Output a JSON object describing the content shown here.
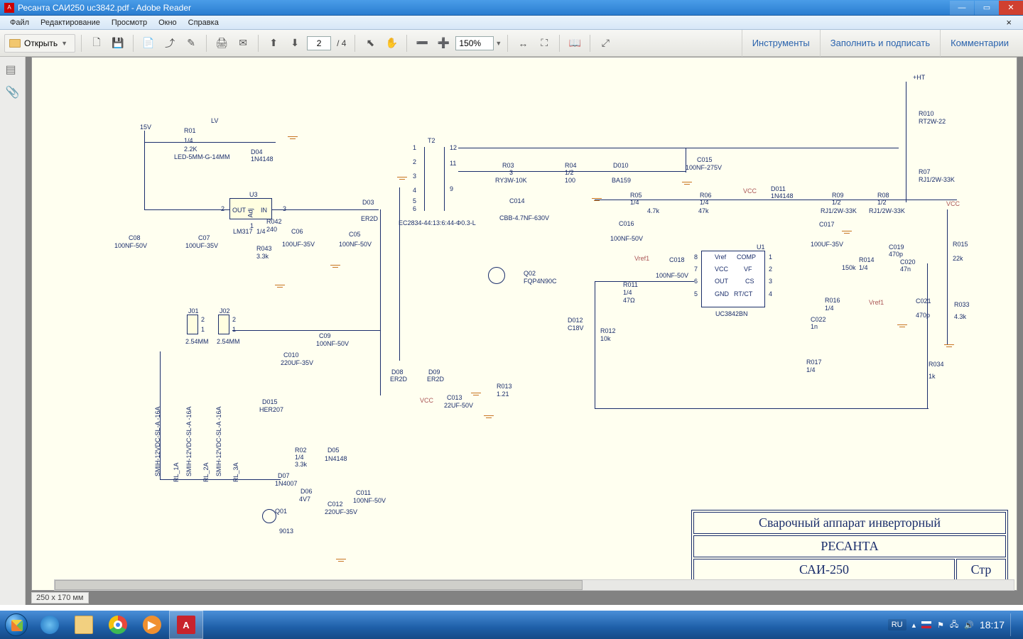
{
  "window": {
    "title": "Ресанта САИ250 uc3842.pdf - Adobe Reader",
    "app": "Adobe Reader"
  },
  "menu": {
    "file": "Файл",
    "edit": "Редактирование",
    "view": "Просмотр",
    "window": "Окно",
    "help": "Справка"
  },
  "toolbar": {
    "open": "Открыть",
    "page_current": "2",
    "page_total": "/ 4",
    "zoom": "150%"
  },
  "right_panel": {
    "tools": "Инструменты",
    "fill_sign": "Заполнить и подписать",
    "comments": "Комментарии"
  },
  "doc_status": {
    "dims": "250 x 170 мм"
  },
  "title_block": {
    "row1": "Сварочный аппарат инверторный",
    "row2": "РЕСАНТА",
    "row3": "САИ-250",
    "row3_right": "Стр"
  },
  "schematic_labels": {
    "v15": "15V",
    "r01a": "R01",
    "r01b": "1/4",
    "r01c": "2.2K",
    "lv": "LV",
    "led": "LED-5MM-G-14MM",
    "d04a": "D04",
    "d04b": "1N4148",
    "u3": "U3",
    "u3_out": "OUT",
    "u3_in": "IN",
    "u3_adj": "Adj",
    "lm317": "LM317",
    "r042a": "R042",
    "r042b": "1/4",
    "r042c": "240",
    "r043a": "R043",
    "r043b": "3.3k",
    "c08a": "C08",
    "c08b": "100NF-50V",
    "c07a": "C07",
    "c07b": "100UF-35V",
    "c06a": "C06",
    "c06b": "100UF-35V",
    "c05a": "C05",
    "c05b": "100NF-50V",
    "d03a": "D03",
    "d03b": "ER2D",
    "t2": "T2",
    "t2_1": "1",
    "t2_2": "2",
    "t2_3": "3",
    "t2_4": "4",
    "t2_5": "5",
    "t2_6": "6",
    "t2_9": "9",
    "t2_11": "11",
    "t2_12": "12",
    "trans": "EC2834-44:13:6:44-Φ0.3-L",
    "r03a": "R03",
    "r03b": "3",
    "r03c": "RY3W-10K",
    "r04a": "R04",
    "r04b": "1/2",
    "r04c": "100",
    "d010a": "D010",
    "d010b": "BA159",
    "c014a": "C014",
    "c014b": "CBB-4.7NF-630V",
    "c015a": "C015",
    "c015b": "100NF-275V",
    "r05a": "R05",
    "r05b": "1/4",
    "r05c": "4.7k",
    "r06a": "R06",
    "r06b": "1/4",
    "r06c": "47k",
    "c016a": "C016",
    "c016b": "100NF-50V",
    "vcc": "VCC",
    "d011a": "D011",
    "d011b": "1N4148",
    "r09a": "R09",
    "r09b": "1/2",
    "r09c": "RJ1/2W-33K",
    "r08a": "R08",
    "r08b": "1/2",
    "r08c": "RJ1/2W-33K",
    "r07a": "R07",
    "r07b": "RJ1/2W-33K",
    "r010a": "R010",
    "r010b": "RT2W-22",
    "ht": "+HT",
    "c017a": "C017",
    "c017b": "100UF-35V",
    "c018a": "C018",
    "c018b": "100NF-50V",
    "vref1a": "Vref1",
    "vref1b": "Vref1",
    "u1": "U1",
    "u1_vref": "Vref",
    "u1_comp": "COMP",
    "u1_vcc": "VCC",
    "u1_vf": "VF",
    "u1_out": "OUT",
    "u1_cs": "CS",
    "u1_gnd": "GND",
    "u1_rtct": "RT/CT",
    "u1_p1": "1",
    "u1_p2": "2",
    "u1_p3": "3",
    "u1_p4": "4",
    "u1_p5": "5",
    "u1_p6": "6",
    "u1_p7": "7",
    "u1_p8": "8",
    "uc3842": "UC3842BN",
    "r014a": "R014",
    "r014b": "1/4",
    "r014c": "150k",
    "c019a": "C019",
    "c019b": "470p",
    "c020a": "C020",
    "c020b": "47n",
    "r015a": "R015",
    "r015b": "22k",
    "r033a": "R033",
    "r033b": "4.3k",
    "r034a": "R034",
    "r034b": "1k",
    "c021a": "C021",
    "c021b": "470p",
    "r016a": "R016",
    "r016b": "1/4",
    "c022a": "C022",
    "c022b": "1n",
    "r017a": "R017",
    "r017b": "1/4",
    "r011a": "R011",
    "r011b": "1/4",
    "r011c": "47Ω",
    "q02a": "Q02",
    "q02b": "FQP4N90C",
    "d012a": "D012",
    "d012b": "C18V",
    "r012a": "R012",
    "r012b": "10k",
    "r013a": "R013",
    "r013b": "1.21",
    "c013a": "C013",
    "c013b": "22UF-50V",
    "d08a": "D08",
    "d08b": "ER2D",
    "d09a": "D09",
    "d09b": "ER2D",
    "j01a": "J01",
    "j01b": "2.54MM",
    "j02a": "J02",
    "j02b": "2.54MM",
    "j_1": "1",
    "j_2": "2",
    "c09a": "C09",
    "c09b": "100NF-50V",
    "c010a": "C010",
    "c010b": "220UF-35V",
    "d015a": "D015",
    "d015b": "HER207",
    "rl1": "SMIH-12VDC-SL-A -16A",
    "rl2": "SMIH-12VDC-SL-A -16A",
    "rl3": "SMIH-12VDC-SL-A -16A",
    "rl1n": "RL_1A",
    "rl2n": "RL_2A",
    "rl3n": "RL_3A",
    "r02a": "R02",
    "r02b": "1/4",
    "r02c": "3.3k",
    "d05a": "D05",
    "d05b": "1N4148",
    "d07a": "D07",
    "d07b": "1N4007",
    "d06a": "D06",
    "d06b": "4V7",
    "c011a": "C011",
    "c011b": "100NF-50V",
    "c012a": "C012",
    "c012b": "220UF-35V",
    "q01a": "Q01",
    "q01b": "9013"
  },
  "taskbar": {
    "lang": "RU",
    "time": "18:17"
  }
}
